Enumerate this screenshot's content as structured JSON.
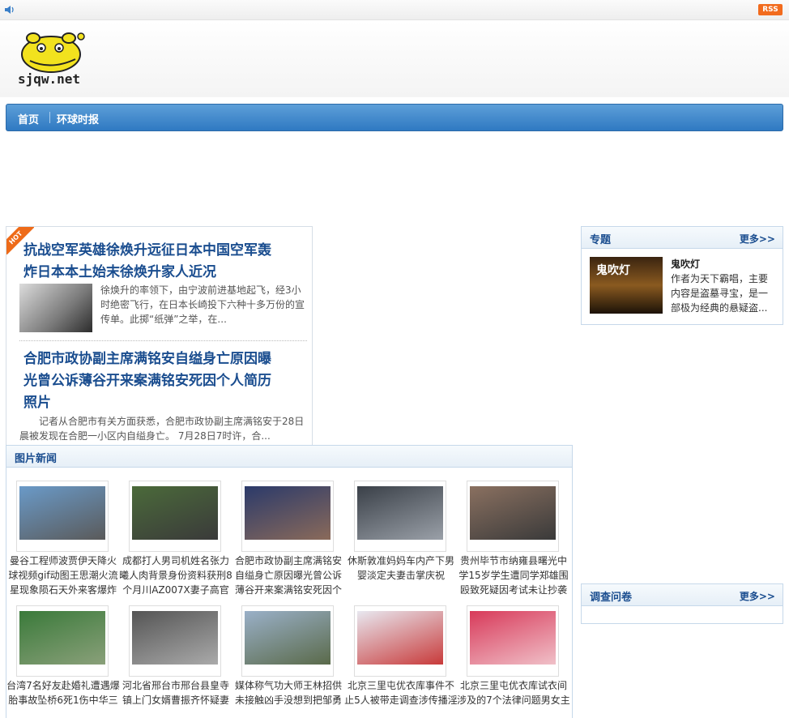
{
  "topbar": {
    "rss_label": "RSS"
  },
  "site": {
    "logo_text": "sjqw.net"
  },
  "nav": {
    "items": [
      {
        "label": "首页"
      },
      {
        "label": "环球时报"
      }
    ]
  },
  "hot": {
    "badge": "HOT",
    "articles": [
      {
        "title_line1": "抗战空军英雄徐焕升远征日本中国空军轰",
        "title_line2": "炸日本本土始末徐焕升家人近况",
        "summary_line1": "徐焕升的率领下，由宁波前进基地起飞，经3小",
        "summary_line2": "时绝密飞行，在日本长崎投下六种十多万份的宣",
        "summary_line3": "传单。此掷“纸弹”之举，在..."
      },
      {
        "title_line1": "合肥市政协副主席满铭安自缢身亡原因曝",
        "title_line2": "光曾公诉薄谷开来案满铭安死因个人简历",
        "title_line3": "照片",
        "summary_line1": "记者从合肥市有关方面获悉，合肥市政协副主席满铭安于28日",
        "summary_line2": "晨被发现在合肥一小区内自缢身亡。    7月28日7时许，合..."
      }
    ]
  },
  "picnews": {
    "title": "图片新闻",
    "items": [
      {
        "cap1": "曼谷工程师波贾伊天降火",
        "cap2": "球视频gif动图王思潮火流",
        "cap3": "星现象陨石天外来客爆炸"
      },
      {
        "cap1": "成都打人男司机姓名张力",
        "cap2": "曦人肉背景身份资料获刑8",
        "cap3": "个月川AZ007X妻子高官警"
      },
      {
        "cap1": "合肥市政协副主席满铭安",
        "cap2": "自缢身亡原因曝光曾公诉",
        "cap3": "薄谷开来案满铭安死因个"
      },
      {
        "cap1": "休斯敦准妈妈车内产下男",
        "cap2": "婴淡定夫妻击掌庆祝",
        "cap3": ""
      },
      {
        "cap1": "贵州毕节市纳雍县曙光中",
        "cap2": "学15岁学生遭同学郑雄围",
        "cap3": "殴致死疑因考试未让抄袭"
      },
      {
        "cap1": "台湾7名好友赴婚礼遭遇爆",
        "cap2": "胎事故坠桥6死1伤中华三",
        "cap3": ""
      },
      {
        "cap1": "河北省邢台市邢台县皇寺",
        "cap2": "镇上门女婿曹振齐怀疑妻",
        "cap3": ""
      },
      {
        "cap1": "媒体称气功大师王林招供",
        "cap2": "未接触凶手没想到把邹勇",
        "cap3": ""
      },
      {
        "cap1": "北京三里屯优衣库事件不",
        "cap2": "止5人被带走调查涉传播淫",
        "cap3": ""
      },
      {
        "cap1": "北京三里屯优衣库试衣间",
        "cap2": "涉及的7个法律问题男女主",
        "cap3": ""
      }
    ]
  },
  "topics": {
    "title": "专题",
    "more": "更多>>",
    "item_name": "鬼吹灯",
    "thumb_text": "鬼吹灯",
    "desc": "作者为天下霸唱，主要内容是盗墓寻宝，是一部极为经典的悬疑盗..."
  },
  "survey": {
    "title": "调查问卷",
    "more": "更多>>"
  },
  "colors": {
    "link_blue": "#1a4d8f",
    "nav_blue": "#2f79c2",
    "hot_orange": "#ee6b19",
    "rss_orange": "#f26b1d"
  }
}
